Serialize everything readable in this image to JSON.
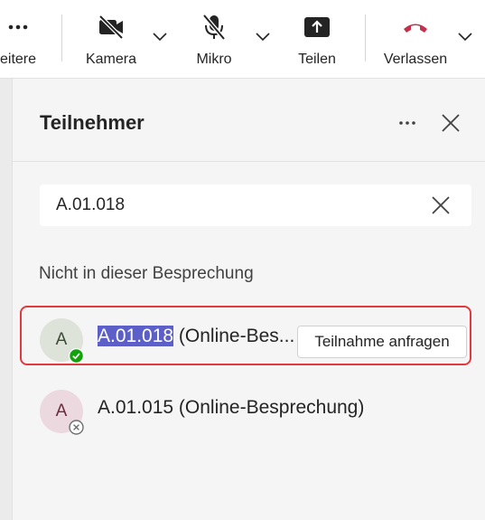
{
  "toolbar": {
    "more_label": "eitere",
    "camera_label": "Kamera",
    "mic_label": "Mikro",
    "share_label": "Teilen",
    "leave_label": "Verlassen"
  },
  "panel": {
    "title": "Teilnehmer",
    "search": {
      "value": "A.01.018"
    },
    "section_label": "Nicht in dieser Besprechung",
    "participants": [
      {
        "initial": "A",
        "name_highlight": "A.01.018",
        "name_rest": " (Online-Bes...",
        "presence": "available",
        "action_label": "Teilnahme anfragen"
      },
      {
        "initial": "A",
        "name": "A.01.015 (Online-Besprechung)",
        "presence": "offline"
      }
    ]
  },
  "colors": {
    "accent": "#5b5fc7",
    "leave_red": "#c4314b",
    "highlight_border": "#e0393e",
    "presence_green": "#13a10e"
  }
}
